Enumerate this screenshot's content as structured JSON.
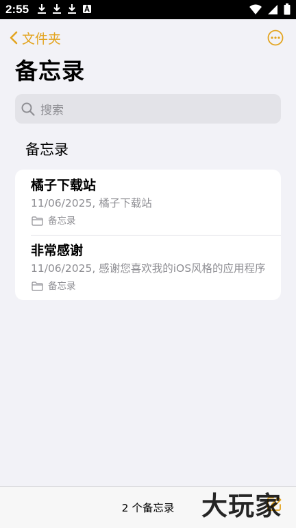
{
  "status_bar": {
    "time": "2:55",
    "icons_left": [
      "download-icon",
      "download-icon",
      "download-icon",
      "font-a-icon"
    ],
    "icons_right": [
      "wifi-icon",
      "signal-icon",
      "battery-icon"
    ]
  },
  "nav": {
    "back_label": "文件夹",
    "accent_color": "#e3a41f"
  },
  "page": {
    "title": "备忘录"
  },
  "search": {
    "placeholder": "搜索"
  },
  "section": {
    "title": "备忘录"
  },
  "notes": [
    {
      "title": "橘子下载站",
      "preview": "11/06/2025, 橘子下载站",
      "folder": "备忘录"
    },
    {
      "title": "非常感谢",
      "preview": "11/06/2025, 感谢您喜欢我的iOS风格的应用程序",
      "folder": "备忘录"
    }
  ],
  "bottom": {
    "count": "2 个备忘录"
  },
  "watermark": {
    "text": "大玩家"
  }
}
